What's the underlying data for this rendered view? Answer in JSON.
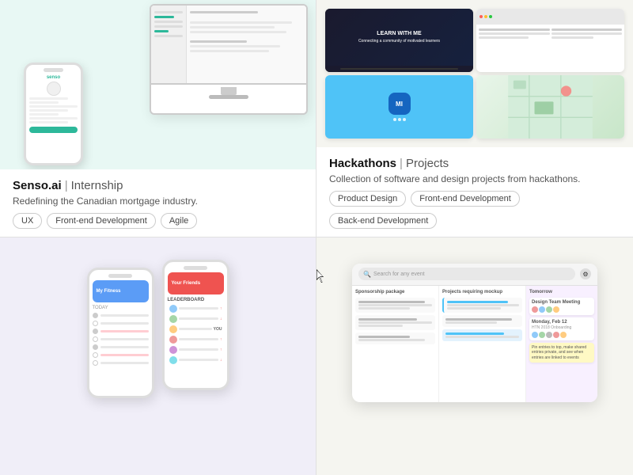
{
  "cards": [
    {
      "id": "senso",
      "title_company": "Senso.ai",
      "title_divider": "|",
      "title_type": "Internship",
      "description": "Redefining the Canadian mortgage industry.",
      "tags": [
        "UX",
        "Front-end Development",
        "Agile"
      ]
    },
    {
      "id": "hackathons",
      "title_company": "Hackathons",
      "title_divider": "|",
      "title_type": "Projects",
      "description": "Collection of software and design projects from hackathons.",
      "tags": [
        "Product Design",
        "Front-end Development",
        "Back-end Development"
      ]
    },
    {
      "id": "fitness",
      "title_company": "",
      "title_divider": "",
      "title_type": "",
      "description": "",
      "tags": []
    },
    {
      "id": "taskmanager",
      "title_company": "",
      "title_divider": "",
      "title_type": "",
      "description": "",
      "tags": []
    }
  ],
  "search_placeholder": "Search for any event",
  "task_columns": [
    "Sponsorship package",
    "Projects requiring mockup",
    "Tomorrow"
  ],
  "icons": {
    "search": "🔍",
    "gear": "⚙"
  }
}
